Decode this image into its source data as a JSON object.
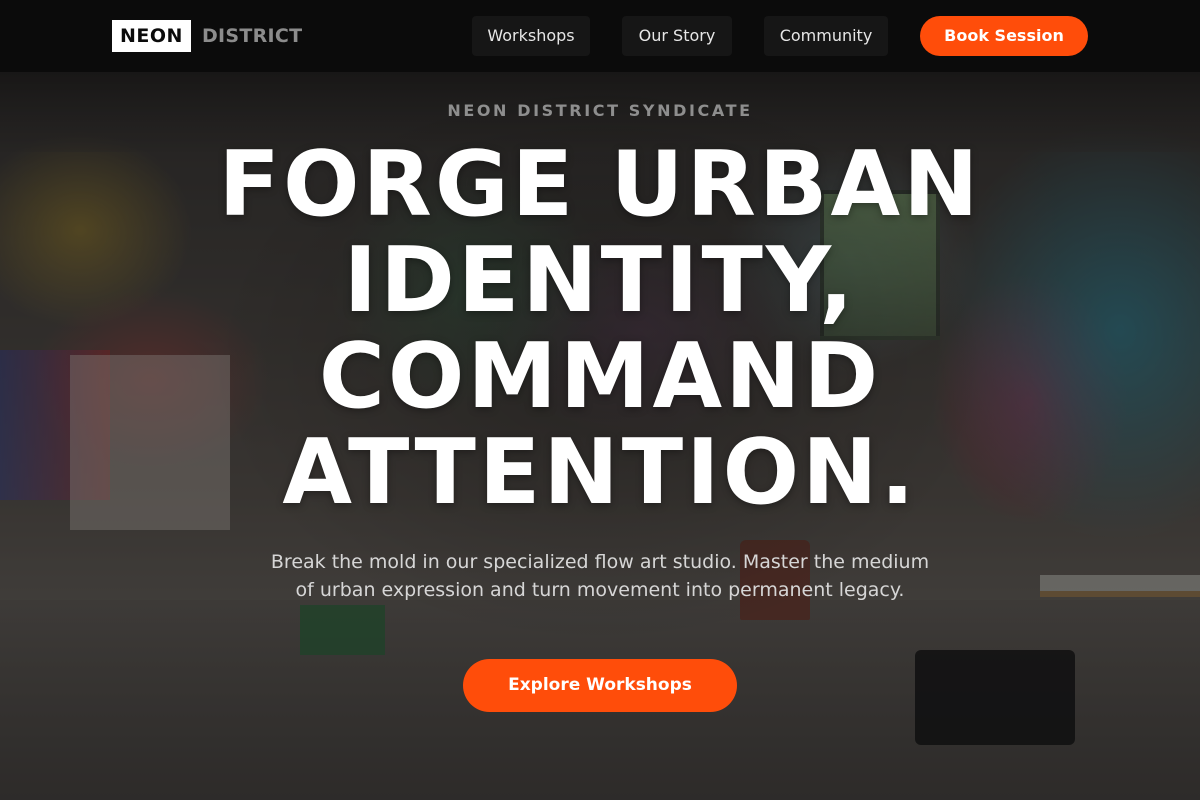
{
  "nav": {
    "logo_box": "NEON",
    "logo_text": "DISTRICT",
    "links": [
      {
        "label": "Workshops"
      },
      {
        "label": "Our Story"
      },
      {
        "label": "Community"
      }
    ],
    "cta_label": "Book Session"
  },
  "hero": {
    "eyebrow": "NEON DISTRICT SYNDICATE",
    "headline": "FORGE URBAN IDENTITY, COMMAND ATTENTION.",
    "subtext": "Break the mold in our specialized flow art studio. Master the medium of urban expression and turn movement into permanent legacy.",
    "cta_label": "Explore Workshops",
    "background": "graffiti-studio-photo"
  },
  "colors": {
    "accent": "#ff4d0a",
    "nav_bg": "#0b0b0b",
    "headline": "#ffffff",
    "eyebrow": "#8e8e8e"
  }
}
